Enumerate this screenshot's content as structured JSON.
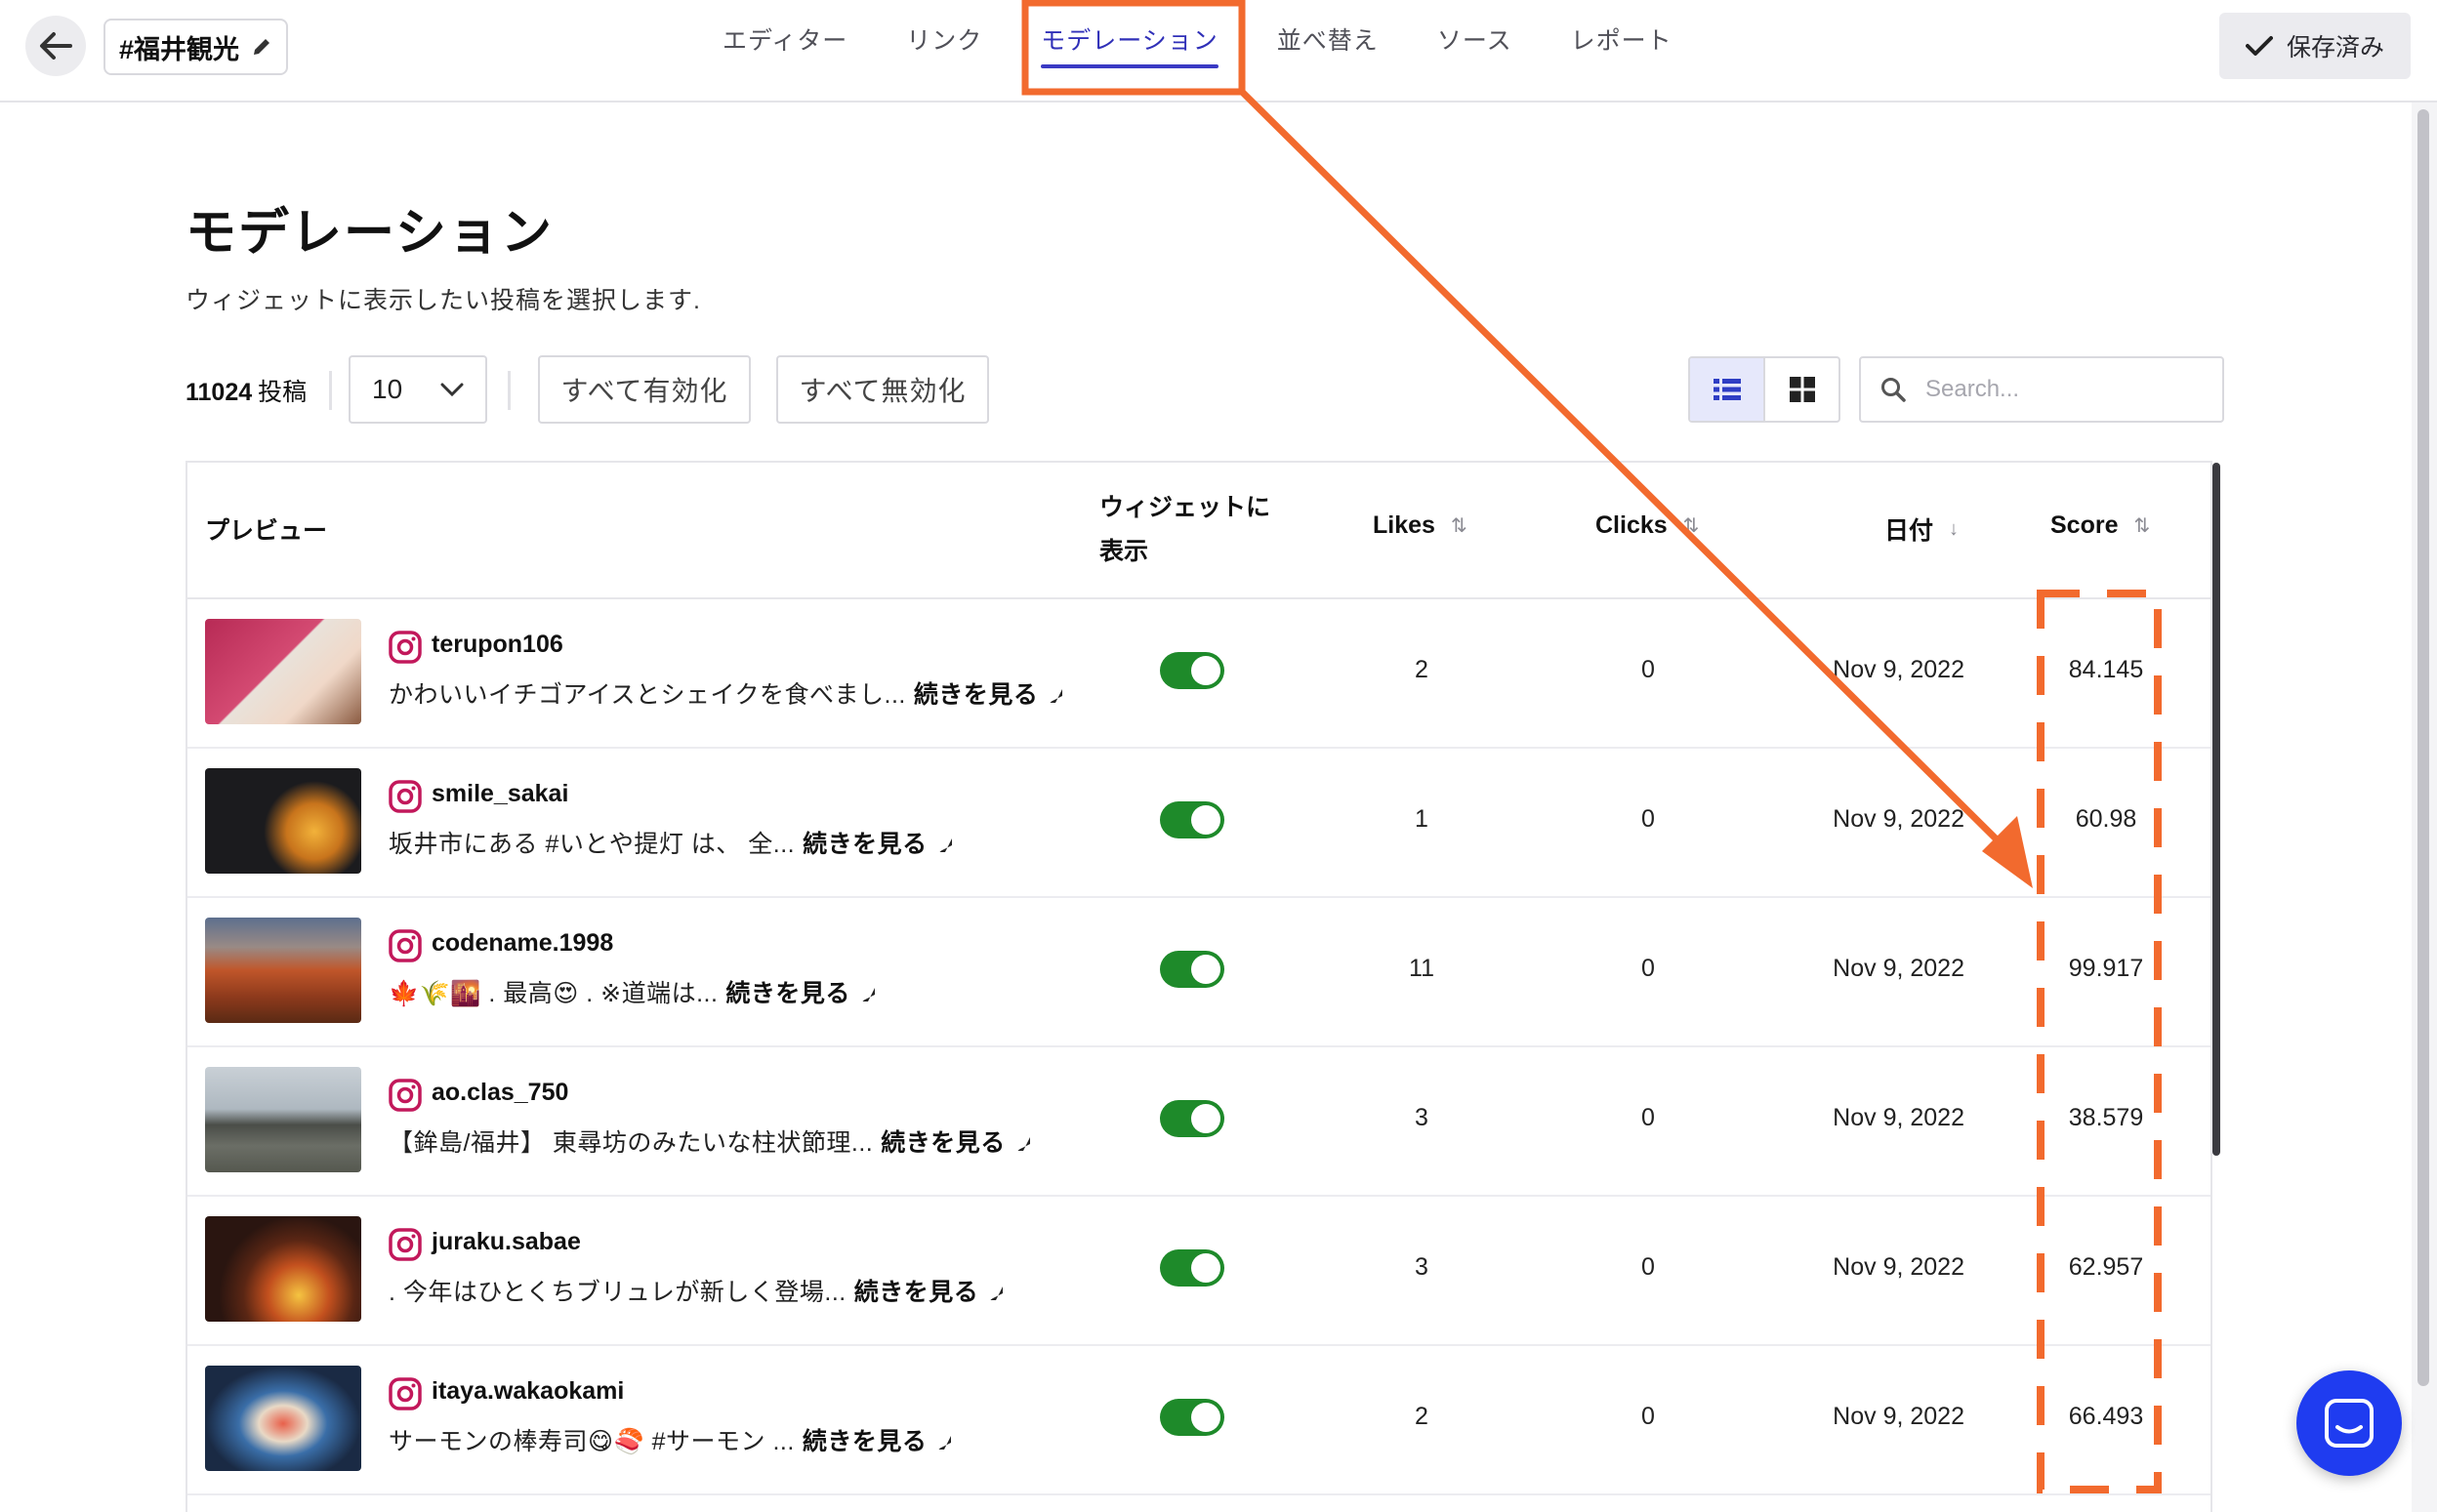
{
  "header": {
    "title": "#福井観光",
    "save_label": "保存済み",
    "tabs": [
      {
        "label": "エディター",
        "active": false
      },
      {
        "label": "リンク",
        "active": false
      },
      {
        "label": "モデレーション",
        "active": true
      },
      {
        "label": "並べ替え",
        "active": false
      },
      {
        "label": "ソース",
        "active": false
      },
      {
        "label": "レポート",
        "active": false
      }
    ]
  },
  "page": {
    "title": "モデレーション",
    "subtitle": "ウィジェットに表示したい投稿を選択します."
  },
  "toolbar": {
    "count": "11024",
    "count_unit": "投稿",
    "per_page": "10",
    "enable_all": "すべて有効化",
    "disable_all": "すべて無効化",
    "search_placeholder": "Search...",
    "view_mode": "list"
  },
  "table": {
    "columns": {
      "preview": "プレビュー",
      "widget_line1": "ウィジェットに",
      "widget_line2": "表示",
      "likes": "Likes",
      "clicks": "Clicks",
      "date": "日付",
      "score": "Score"
    },
    "read_more": "続きを見る",
    "rows": [
      {
        "user": "terupon106",
        "caption": "かわいいイチゴアイスとシェイクを食べまし...",
        "likes": "2",
        "clicks": "0",
        "date": "Nov 9, 2022",
        "score": "84.145",
        "shown": true
      },
      {
        "user": "smile_sakai",
        "caption": "坂井市にある #いとや提灯 は、 全...",
        "likes": "1",
        "clicks": "0",
        "date": "Nov 9, 2022",
        "score": "60.98",
        "shown": true
      },
      {
        "user": "codename.1998",
        "caption": "🍁🌾🌇 . 最高😍 . ※道端は...",
        "likes": "11",
        "clicks": "0",
        "date": "Nov 9, 2022",
        "score": "99.917",
        "shown": true
      },
      {
        "user": "ao.clas_750",
        "caption": "【鉾島/福井】 東尋坊のみたいな柱状節理...",
        "likes": "3",
        "clicks": "0",
        "date": "Nov 9, 2022",
        "score": "38.579",
        "shown": true
      },
      {
        "user": "juraku.sabae",
        "caption": ". 今年はひとくちブリュレが新しく登場...",
        "likes": "3",
        "clicks": "0",
        "date": "Nov 9, 2022",
        "score": "62.957",
        "shown": true
      },
      {
        "user": "itaya.wakaokami",
        "caption": "サーモンの棒寿司😋🍣 #サーモン ...",
        "likes": "2",
        "clicks": "0",
        "date": "Nov 9, 2022",
        "score": "66.493",
        "shown": true
      }
    ]
  },
  "colors": {
    "accent": "#3a3ac4",
    "toggle_on": "#1e8a2a",
    "annotation": "#f26a2e",
    "chat": "#1f3cf0"
  }
}
